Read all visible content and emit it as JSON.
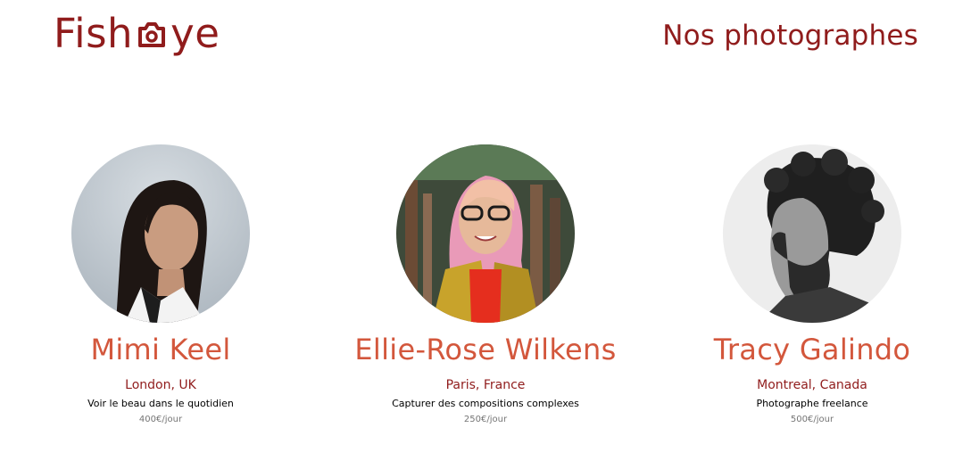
{
  "header": {
    "logo": {
      "before": "Fish",
      "after": "ye",
      "icon": "camera-icon"
    },
    "title": "Nos photographes"
  },
  "photographers": [
    {
      "name": "Mimi Keel",
      "location": "London, UK",
      "tagline": "Voir le beau dans le quotidien",
      "price": "400€/jour"
    },
    {
      "name": "Ellie-Rose Wilkens",
      "location": "Paris, France",
      "tagline": "Capturer des compositions complexes",
      "price": "250€/jour"
    },
    {
      "name": "Tracy Galindo",
      "location": "Montreal, Canada",
      "tagline": "Photographe freelance",
      "price": "500€/jour"
    }
  ],
  "colors": {
    "brand": "#901C1C",
    "accent": "#D3573C",
    "muted": "#757575"
  }
}
